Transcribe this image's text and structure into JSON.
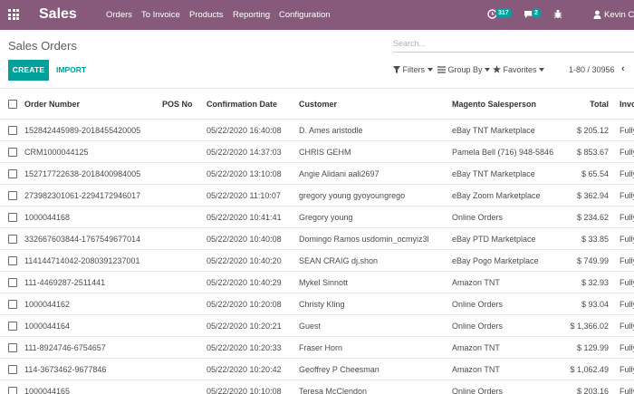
{
  "navbar": {
    "app_name": "Sales",
    "menu": [
      "Orders",
      "To Invoice",
      "Products",
      "Reporting",
      "Configuration"
    ],
    "activity_count": "317",
    "message_count": "2",
    "user_name": "Kevin Clor (te"
  },
  "control": {
    "title": "Sales Orders",
    "search_placeholder": "Search...",
    "create_label": "CREATE",
    "import_label": "IMPORT",
    "filters_label": "Filters",
    "groupby_label": "Group By",
    "favorites_label": "Favorites",
    "pager": "1-80 / 30956"
  },
  "table": {
    "headers": {
      "order_number": "Order Number",
      "pos_no": "POS No",
      "confirmation_date": "Confirmation Date",
      "customer": "Customer",
      "salesperson": "Magento Salesperson",
      "total": "Total",
      "invoice": "Invo"
    },
    "rows": [
      {
        "num": "152842445989-2018455420005",
        "pos": "",
        "date": "05/22/2020 16:40:08",
        "customer": "D. Ames aristodle",
        "sales": "eBay TNT Marketplace",
        "total": "$ 205.12",
        "inv": "Fully"
      },
      {
        "num": "CRM1000044125",
        "pos": "",
        "date": "05/22/2020 14:37:03",
        "customer": "CHRIS GEHM",
        "sales": "Pamela Bell (716) 948-5846",
        "total": "$ 853.67",
        "inv": "Fully"
      },
      {
        "num": "152717722638-2018400984005",
        "pos": "",
        "date": "05/22/2020 13:10:08",
        "customer": "Angie Alidani aali2697",
        "sales": "eBay TNT Marketplace",
        "total": "$ 65.54",
        "inv": "Fully"
      },
      {
        "num": "273982301061-2294172946017",
        "pos": "",
        "date": "05/22/2020 11:10:07",
        "customer": "gregory young gyoyoungrego",
        "sales": "eBay Zoom Marketplace",
        "total": "$ 362.94",
        "inv": "Fully"
      },
      {
        "num": "1000044168",
        "pos": "",
        "date": "05/22/2020 10:41:41",
        "customer": "Gregory young",
        "sales": "Online Orders",
        "total": "$ 234.62",
        "inv": "Fully"
      },
      {
        "num": "332667603844-1767549677014",
        "pos": "",
        "date": "05/22/2020 10:40:08",
        "customer": "Domingo Ramos usdomin_ocmyiz3l",
        "sales": "eBay PTD Marketplace",
        "total": "$ 33.85",
        "inv": "Fully"
      },
      {
        "num": "114144714042-2080391237001",
        "pos": "",
        "date": "05/22/2020 10:40:20",
        "customer": "SEAN CRAIG dj.shon",
        "sales": "eBay Pogo Marketplace",
        "total": "$ 749.99",
        "inv": "Fully"
      },
      {
        "num": "111-4469287-2511441",
        "pos": "",
        "date": "05/22/2020 10:40:29",
        "customer": "Mykel Sinnott",
        "sales": "Amazon TNT",
        "total": "$ 32.93",
        "inv": "Fully"
      },
      {
        "num": "1000044162",
        "pos": "",
        "date": "05/22/2020 10:20:08",
        "customer": "Christy Kling",
        "sales": "Online Orders",
        "total": "$ 93.04",
        "inv": "Fully"
      },
      {
        "num": "1000044164",
        "pos": "",
        "date": "05/22/2020 10:20:21",
        "customer": "Guest",
        "sales": "Online Orders",
        "total": "$ 1,366.02",
        "inv": "Fully"
      },
      {
        "num": "111-8924746-6754657",
        "pos": "",
        "date": "05/22/2020 10:20:33",
        "customer": "Fraser Horn",
        "sales": "Amazon TNT",
        "total": "$ 129.99",
        "inv": "Fully"
      },
      {
        "num": "114-3673462-9677846",
        "pos": "",
        "date": "05/22/2020 10:20:42",
        "customer": "Geoffrey P Cheesman",
        "sales": "Amazon TNT",
        "total": "$ 1,062.49",
        "inv": "Fully"
      },
      {
        "num": "1000044165",
        "pos": "",
        "date": "05/22/2020 10:10:08",
        "customer": "Teresa McClendon",
        "sales": "Online Orders",
        "total": "$ 203.16",
        "inv": "Fully"
      }
    ]
  }
}
